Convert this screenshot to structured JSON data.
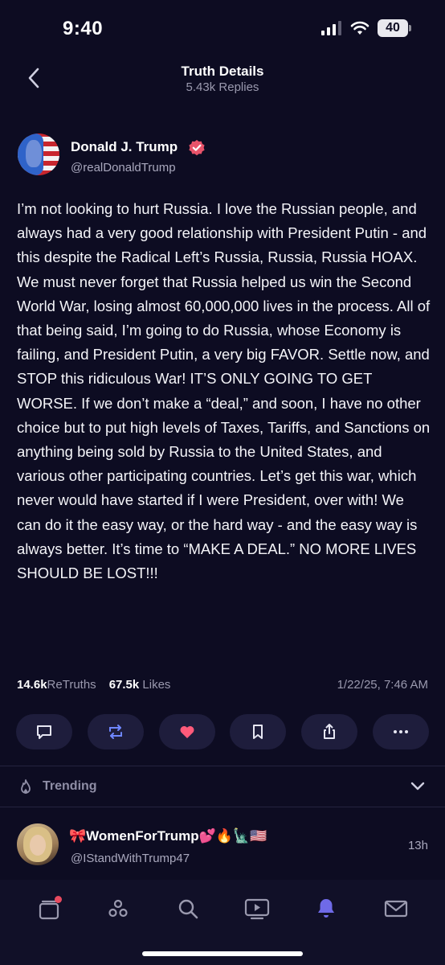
{
  "status_bar": {
    "time": "9:40",
    "battery": "40"
  },
  "header": {
    "title": "Truth Details",
    "subtitle": "5.43k Replies"
  },
  "post": {
    "author_name": "Donald J. Trump",
    "author_handle": "@realDonaldTrump",
    "body": "I’m not looking to hurt Russia. I love the Russian people, and always had a very good relationship with President Putin - and this despite the Radical Left’s Russia, Russia, Russia HOAX. We must never forget that Russia helped us win the Second World War, losing almost 60,000,000 lives in the process. All of that being said, I’m going to do Russia, whose Economy is failing, and President Putin, a very big FAVOR. Settle now, and STOP this ridiculous War! IT’S ONLY GOING TO GET WORSE. If we don’t make a “deal,” and soon, I have no other choice but to put high levels of Taxes, Tariffs, and Sanctions on anything being sold by Russia to the United States, and various other participating countries. Let’s get this war, which never would have started if I were President, over with! We can do it the easy way, or the hard way - and the easy way is always better. It’s time to “MAKE A DEAL.” NO MORE LIVES SHOULD BE LOST!!!",
    "retruths_count": "14.6k",
    "retruths_label": "ReTruths",
    "likes_count": "67.5k",
    "likes_label": "Likes",
    "date": "1/22/25, 7:46 AM"
  },
  "actions": [
    "reply-icon",
    "retruth-icon",
    "like-icon",
    "bookmark-icon",
    "share-icon",
    "more-icon"
  ],
  "trending": {
    "label": "Trending"
  },
  "suggested": {
    "name": "🎀WomenForTrump💕🔥🗽🇺🇸",
    "handle": "@IStandWithTrump47",
    "time": "13h"
  },
  "colors": {
    "background": "#0d0c22",
    "accent": "#5448ee",
    "like": "#ff5a7a",
    "retruth": "#6f87ff"
  }
}
